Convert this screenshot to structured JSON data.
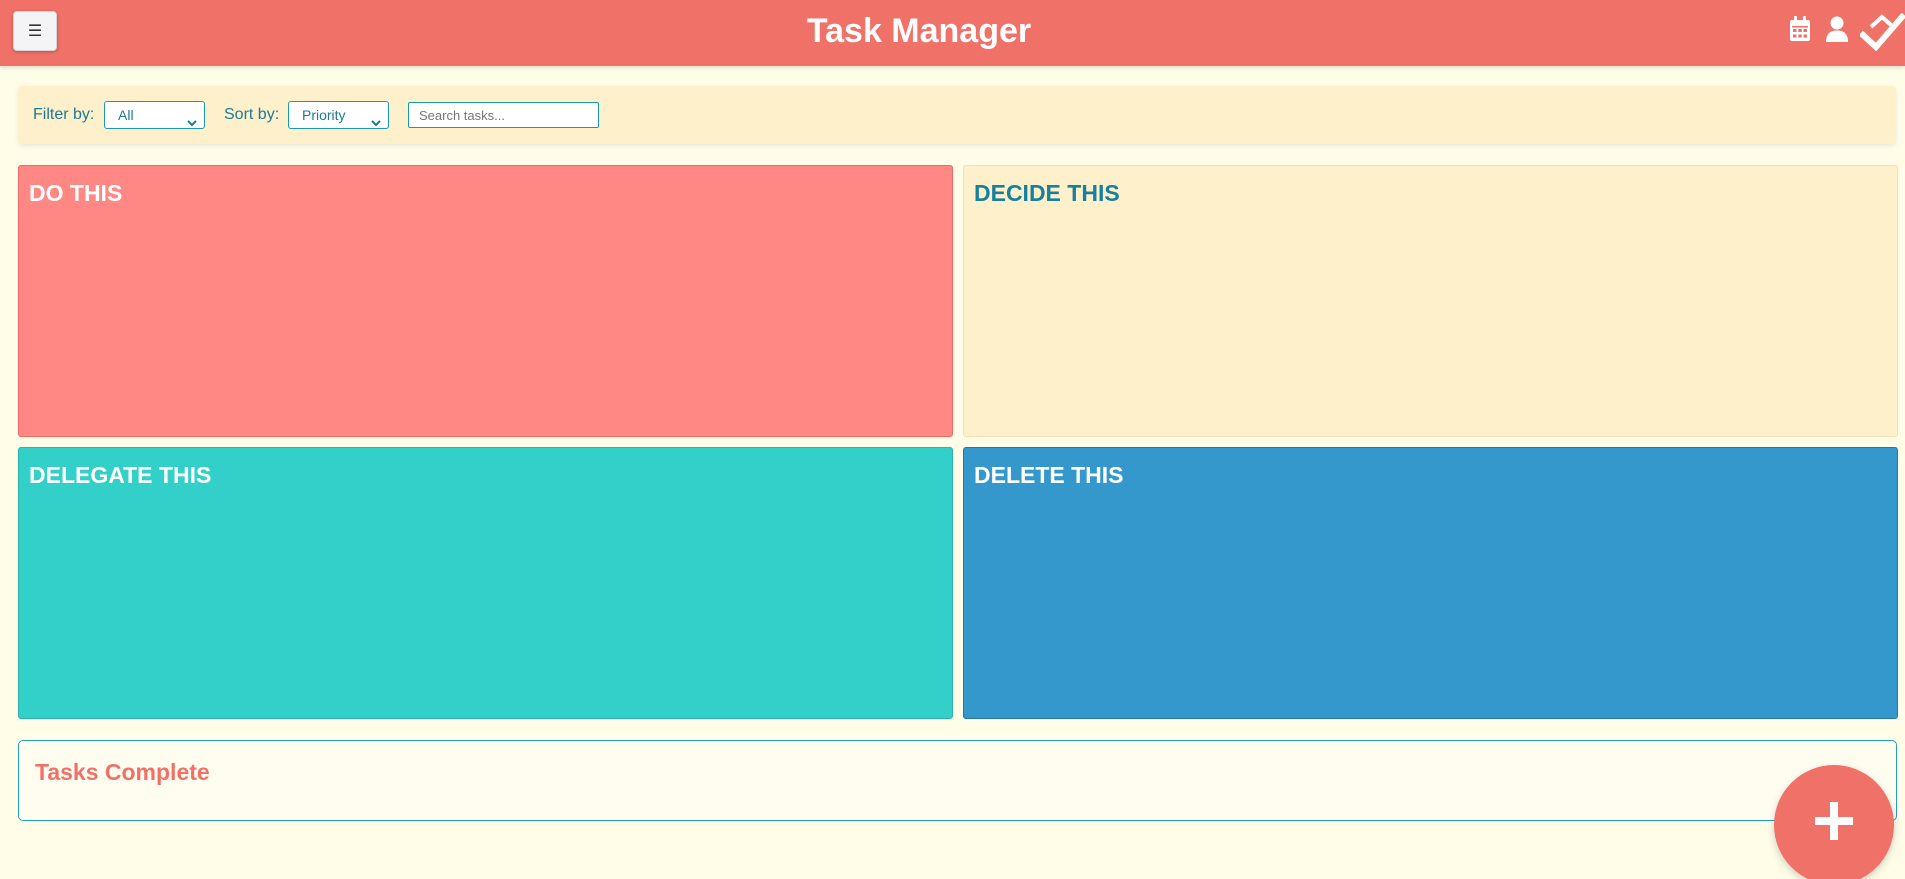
{
  "header": {
    "title": "Task Manager",
    "menu_label": "☰",
    "menu_icon": "hamburger-icon",
    "icons": [
      "calendar-icon",
      "user-icon",
      "checkmark-logo-icon"
    ],
    "bg_color": "#f07167"
  },
  "filter_bar": {
    "filter_label": "Filter by:",
    "filter_value": "All",
    "sort_label": "Sort by:",
    "sort_value": "Priority",
    "search_placeholder": "Search tasks..."
  },
  "quadrants": {
    "do": {
      "title": "DO THIS",
      "color": "#ff8884"
    },
    "decide": {
      "title": "DECIDE THIS",
      "color": "#fff0cc"
    },
    "delegate": {
      "title": "DELEGATE THIS",
      "color": "#33d0c9"
    },
    "delete": {
      "title": "DELETE THIS",
      "color": "#3498cc"
    }
  },
  "completed": {
    "title": "Tasks Complete"
  },
  "fab": {
    "icon": "plus-icon",
    "color": "#f07167"
  }
}
